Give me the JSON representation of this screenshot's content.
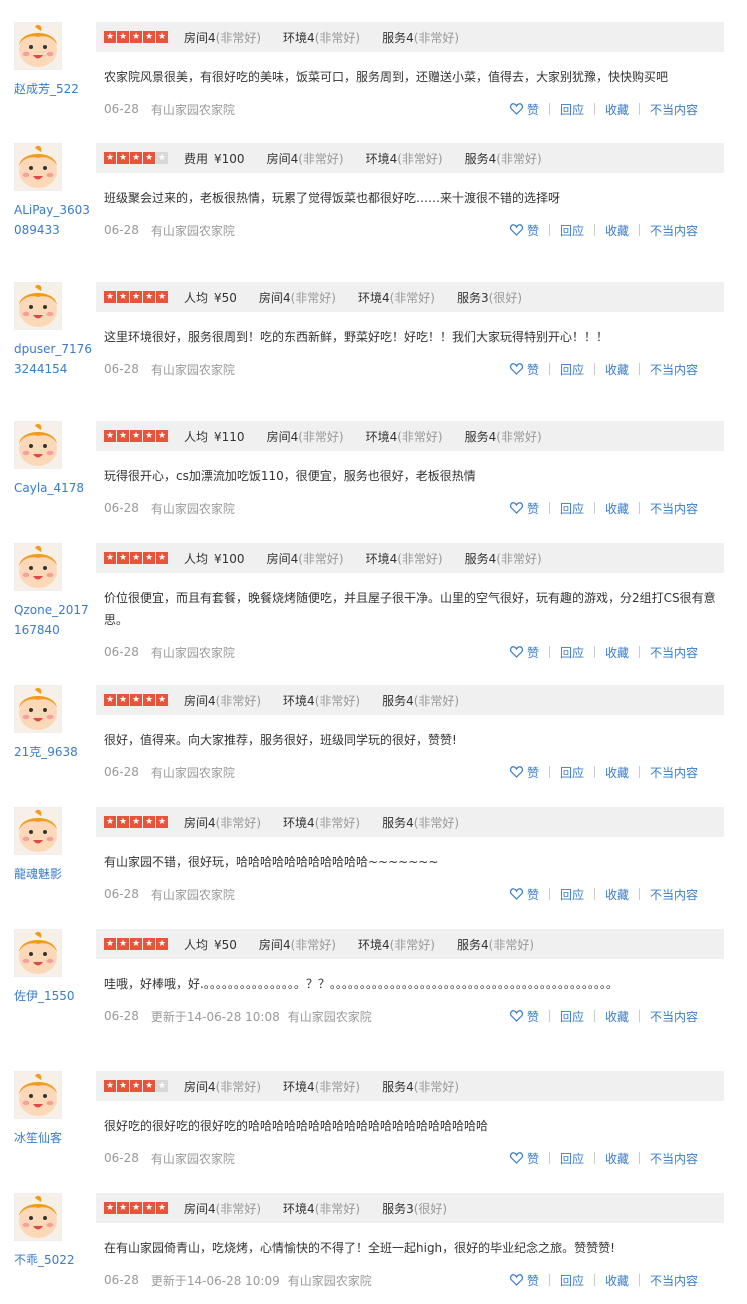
{
  "reviews": [
    {
      "user": "赵成芳_522",
      "stars": 5,
      "price": null,
      "ratings": [
        {
          "name": "房间",
          "score": "4",
          "label": "(非常好)"
        },
        {
          "name": "环境",
          "score": "4",
          "label": "(非常好)"
        },
        {
          "name": "服务",
          "score": "4",
          "label": "(非常好)"
        }
      ],
      "comment": "农家院风景很美，有很好吃的美味，饭菜可口，服务周到，还赠送小菜，值得去，大家别犹豫，快快购买吧",
      "date": "06-28",
      "updated": "",
      "shop": "有山家园农家院"
    },
    {
      "user": "ALiPay_3603089433",
      "stars": 4,
      "price": {
        "label": "费用",
        "value": "¥100"
      },
      "ratings": [
        {
          "name": "房间",
          "score": "4",
          "label": "(非常好)"
        },
        {
          "name": "环境",
          "score": "4",
          "label": "(非常好)"
        },
        {
          "name": "服务",
          "score": "4",
          "label": "(非常好)"
        }
      ],
      "comment": "班级聚会过来的，老板很热情，玩累了觉得饭菜也都很好吃……来十渡很不错的选择呀",
      "date": "06-28",
      "updated": "",
      "shop": "有山家园农家院"
    },
    {
      "user": "dpuser_71763244154",
      "stars": 5,
      "price": {
        "label": "人均",
        "value": "¥50"
      },
      "ratings": [
        {
          "name": "房间",
          "score": "4",
          "label": "(非常好)"
        },
        {
          "name": "环境",
          "score": "4",
          "label": "(非常好)"
        },
        {
          "name": "服务",
          "score": "3",
          "label": "(很好)"
        }
      ],
      "comment": "这里环境很好，服务很周到！吃的东西新鲜，野菜好吃！好吃！！我们大家玩得特别开心！！！",
      "date": "06-28",
      "updated": "",
      "shop": "有山家园农家院"
    },
    {
      "user": "Cayla_4178",
      "stars": 5,
      "price": {
        "label": "人均",
        "value": "¥110"
      },
      "ratings": [
        {
          "name": "房间",
          "score": "4",
          "label": "(非常好)"
        },
        {
          "name": "环境",
          "score": "4",
          "label": "(非常好)"
        },
        {
          "name": "服务",
          "score": "4",
          "label": "(非常好)"
        }
      ],
      "comment": "玩得很开心，cs加漂流加吃饭110，很便宜，服务也很好，老板很热情",
      "date": "06-28",
      "updated": "",
      "shop": "有山家园农家院"
    },
    {
      "user": "Qzone_2017167840",
      "stars": 5,
      "price": {
        "label": "人均",
        "value": "¥100"
      },
      "ratings": [
        {
          "name": "房间",
          "score": "4",
          "label": "(非常好)"
        },
        {
          "name": "环境",
          "score": "4",
          "label": "(非常好)"
        },
        {
          "name": "服务",
          "score": "4",
          "label": "(非常好)"
        }
      ],
      "comment": "价位很便宜，而且有套餐，晚餐烧烤随便吃，并且屋子很干净。山里的空气很好，玩有趣的游戏，分2组打CS很有意思。",
      "date": "06-28",
      "updated": "",
      "shop": "有山家园农家院"
    },
    {
      "user": "21克_9638",
      "stars": 5,
      "price": null,
      "ratings": [
        {
          "name": "房间",
          "score": "4",
          "label": "(非常好)"
        },
        {
          "name": "环境",
          "score": "4",
          "label": "(非常好)"
        },
        {
          "name": "服务",
          "score": "4",
          "label": "(非常好)"
        }
      ],
      "comment": "很好，值得来。向大家推荐，服务很好，班级同学玩的很好，赞赞!",
      "date": "06-28",
      "updated": "",
      "shop": "有山家园农家院"
    },
    {
      "user": "龍魂魅影",
      "stars": 5,
      "price": null,
      "ratings": [
        {
          "name": "房间",
          "score": "4",
          "label": "(非常好)"
        },
        {
          "name": "环境",
          "score": "4",
          "label": "(非常好)"
        },
        {
          "name": "服务",
          "score": "4",
          "label": "(非常好)"
        }
      ],
      "comment": "有山家园不错，很好玩，哈哈哈哈哈哈哈哈哈哈哈~~~~~~~",
      "date": "06-28",
      "updated": "",
      "shop": "有山家园农家院"
    },
    {
      "user": "佐伊_1550",
      "stars": 5,
      "price": {
        "label": "人均",
        "value": "¥50"
      },
      "ratings": [
        {
          "name": "房间",
          "score": "4",
          "label": "(非常好)"
        },
        {
          "name": "环境",
          "score": "4",
          "label": "(非常好)"
        },
        {
          "name": "服务",
          "score": "4",
          "label": "(非常好)"
        }
      ],
      "comment": "哇哦，好棒哦，好.。。。。。。。。。。。。。。。。？？。。。。。。。。。。。。。。。。。。。。。。。。。。。。。。。。。。。。。。。。。。。。。。。",
      "date": "06-28",
      "updated": "更新于14-06-28 10:08",
      "shop": "有山家园农家院"
    },
    {
      "user": "冰笙仙客",
      "stars": 4,
      "price": null,
      "ratings": [
        {
          "name": "房间",
          "score": "4",
          "label": "(非常好)"
        },
        {
          "name": "环境",
          "score": "4",
          "label": "(非常好)"
        },
        {
          "name": "服务",
          "score": "4",
          "label": "(非常好)"
        }
      ],
      "comment": "很好吃的很好吃的很好吃的哈哈哈哈哈哈哈哈哈哈哈哈哈哈哈哈哈哈哈哈",
      "date": "06-28",
      "updated": "",
      "shop": "有山家园农家院"
    },
    {
      "user": "不乖_5022",
      "stars": 5,
      "price": null,
      "ratings": [
        {
          "name": "房间",
          "score": "4",
          "label": "(非常好)"
        },
        {
          "name": "环境",
          "score": "4",
          "label": "(非常好)"
        },
        {
          "name": "服务",
          "score": "3",
          "label": "(很好)"
        }
      ],
      "comment": "在有山家园倚青山，吃烧烤，心情愉快的不得了！全班一起high，很好的毕业纪念之旅。赞赞赞!",
      "date": "06-28",
      "updated": "更新于14-06-28 10:09",
      "shop": "有山家园农家院"
    }
  ],
  "actions": {
    "like": "赞",
    "reply": "回应",
    "favorite": "收藏",
    "report": "不当内容"
  },
  "colors": {
    "star_on": "#e8533b",
    "star_off": "#d8d8d8",
    "link": "#3a7bc8",
    "rate_bg": "#f0f0f0"
  },
  "icons": {
    "star": "star-icon",
    "like": "heart-icon",
    "avatar": "baby-face-avatar"
  }
}
